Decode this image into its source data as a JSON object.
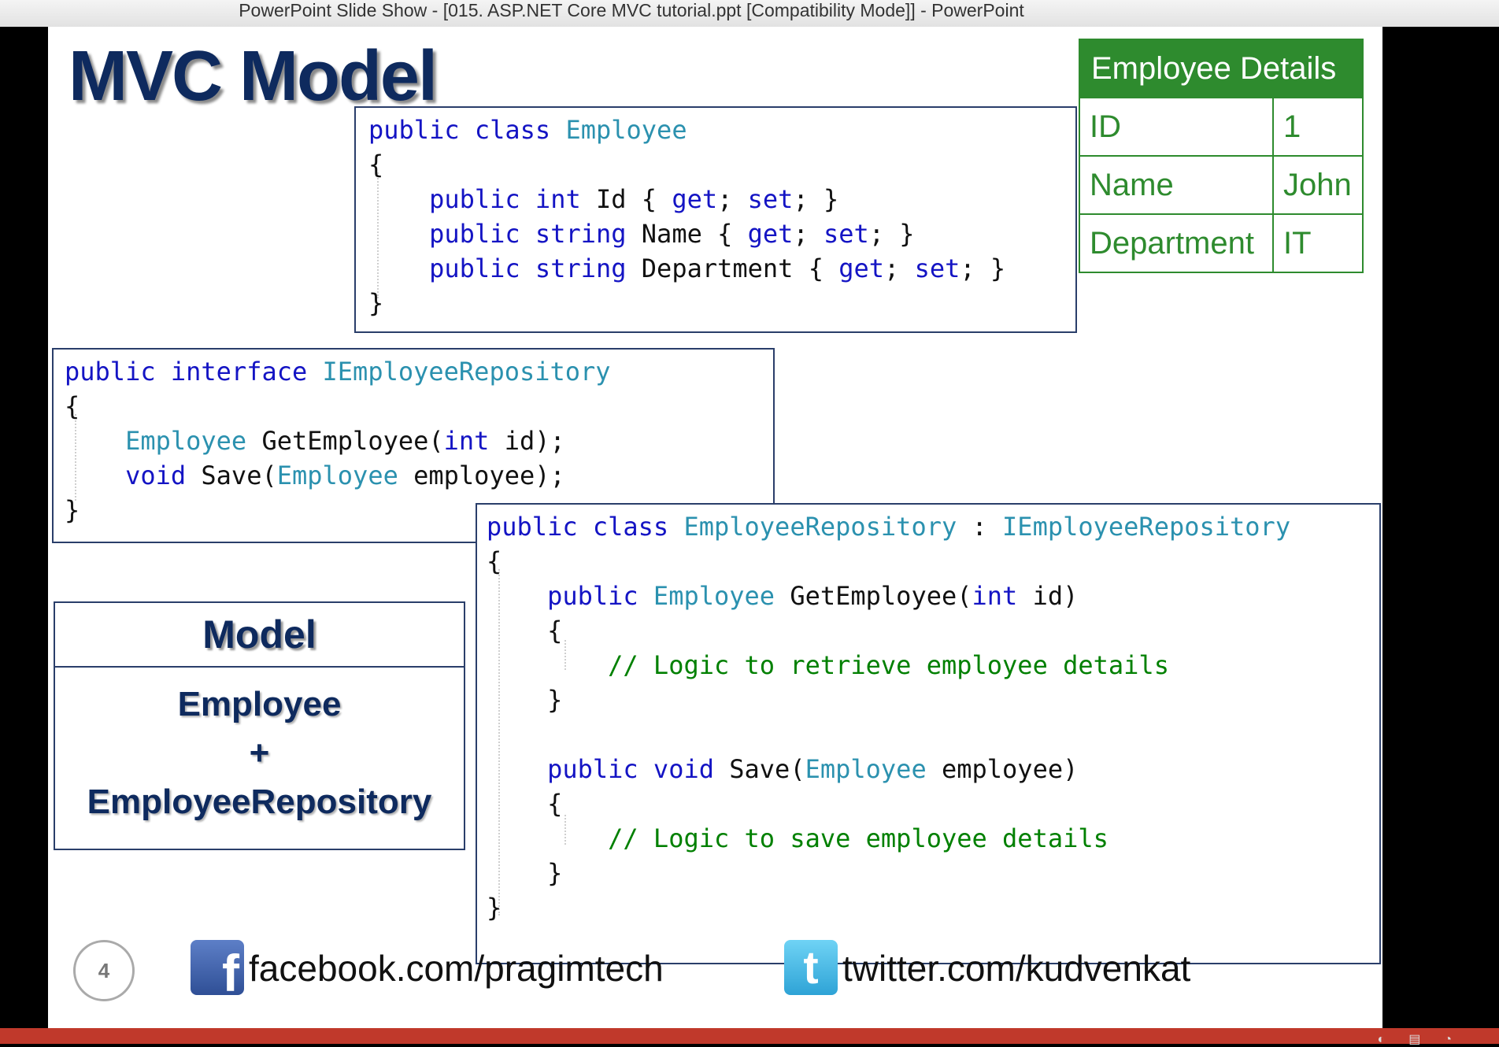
{
  "window": {
    "title": "PowerPoint Slide Show - [015. ASP.NET Core MVC tutorial.ppt [Compatibility Mode]] - PowerPoint"
  },
  "slide": {
    "title": "MVC Model",
    "number": "4",
    "employee_class": {
      "lines": [
        [
          [
            "kw",
            "public "
          ],
          [
            "kw",
            "class "
          ],
          [
            "ty",
            "Employee"
          ]
        ],
        [
          [
            "tx",
            "{"
          ]
        ],
        [
          [
            "tx",
            "    "
          ],
          [
            "kw",
            "public "
          ],
          [
            "kw",
            "int "
          ],
          [
            "tx",
            "Id { "
          ],
          [
            "kw",
            "get"
          ],
          [
            "tx",
            "; "
          ],
          [
            "kw",
            "set"
          ],
          [
            "tx",
            "; }"
          ]
        ],
        [
          [
            "tx",
            "    "
          ],
          [
            "kw",
            "public "
          ],
          [
            "kw",
            "string "
          ],
          [
            "tx",
            "Name { "
          ],
          [
            "kw",
            "get"
          ],
          [
            "tx",
            "; "
          ],
          [
            "kw",
            "set"
          ],
          [
            "tx",
            "; }"
          ]
        ],
        [
          [
            "tx",
            "    "
          ],
          [
            "kw",
            "public "
          ],
          [
            "kw",
            "string "
          ],
          [
            "tx",
            "Department { "
          ],
          [
            "kw",
            "get"
          ],
          [
            "tx",
            "; "
          ],
          [
            "kw",
            "set"
          ],
          [
            "tx",
            "; }"
          ]
        ],
        [
          [
            "tx",
            "}"
          ]
        ]
      ]
    },
    "interface": {
      "lines": [
        [
          [
            "kw",
            "public "
          ],
          [
            "kw",
            "interface "
          ],
          [
            "ty",
            "IEmployeeRepository"
          ]
        ],
        [
          [
            "tx",
            "{"
          ]
        ],
        [
          [
            "tx",
            "    "
          ],
          [
            "ty",
            "Employee "
          ],
          [
            "tx",
            "GetEmployee("
          ],
          [
            "kw",
            "int "
          ],
          [
            "tx",
            "id);"
          ]
        ],
        [
          [
            "tx",
            "    "
          ],
          [
            "kw",
            "void "
          ],
          [
            "tx",
            "Save("
          ],
          [
            "ty",
            "Employee "
          ],
          [
            "tx",
            "employee);"
          ]
        ],
        [
          [
            "tx",
            "}"
          ]
        ]
      ]
    },
    "repository_class": {
      "lines": [
        [
          [
            "kw",
            "public "
          ],
          [
            "kw",
            "class "
          ],
          [
            "ty",
            "EmployeeRepository "
          ],
          [
            "tx",
            ": "
          ],
          [
            "ty",
            "IEmployeeRepository"
          ]
        ],
        [
          [
            "tx",
            "{"
          ]
        ],
        [
          [
            "tx",
            "    "
          ],
          [
            "kw",
            "public "
          ],
          [
            "ty",
            "Employee "
          ],
          [
            "tx",
            "GetEmployee("
          ],
          [
            "kw",
            "int "
          ],
          [
            "tx",
            "id)"
          ]
        ],
        [
          [
            "tx",
            "    {"
          ]
        ],
        [
          [
            "tx",
            "        "
          ],
          [
            "cm",
            "// Logic to retrieve employee details"
          ]
        ],
        [
          [
            "tx",
            "    }"
          ]
        ],
        [
          [
            "tx",
            ""
          ]
        ],
        [
          [
            "tx",
            "    "
          ],
          [
            "kw",
            "public "
          ],
          [
            "kw",
            "void "
          ],
          [
            "tx",
            "Save("
          ],
          [
            "ty",
            "Employee "
          ],
          [
            "tx",
            "employee)"
          ]
        ],
        [
          [
            "tx",
            "    {"
          ]
        ],
        [
          [
            "tx",
            "        "
          ],
          [
            "cm",
            "// Logic to save employee details"
          ]
        ],
        [
          [
            "tx",
            "    }"
          ]
        ],
        [
          [
            "tx",
            "}"
          ]
        ]
      ]
    },
    "employee_table": {
      "header": "Employee Details",
      "rows": [
        {
          "key": "ID",
          "value": "1"
        },
        {
          "key": "Name",
          "value": "John"
        },
        {
          "key": "Department",
          "value": "IT"
        }
      ]
    },
    "model_box": {
      "header": "Model",
      "line1": "Employee",
      "line2": "+",
      "line3": "EmployeeRepository"
    },
    "footer": {
      "facebook_icon": "facebook-icon",
      "facebook": "facebook.com/pragimtech",
      "twitter_icon": "twitter-icon",
      "twitter": "twitter.com/kudvenkat"
    }
  },
  "colors": {
    "keyword": "#1414c4",
    "type": "#2b91af",
    "comment": "#008000",
    "title": "#0e2a5e",
    "table_green": "#2e8b2e"
  }
}
